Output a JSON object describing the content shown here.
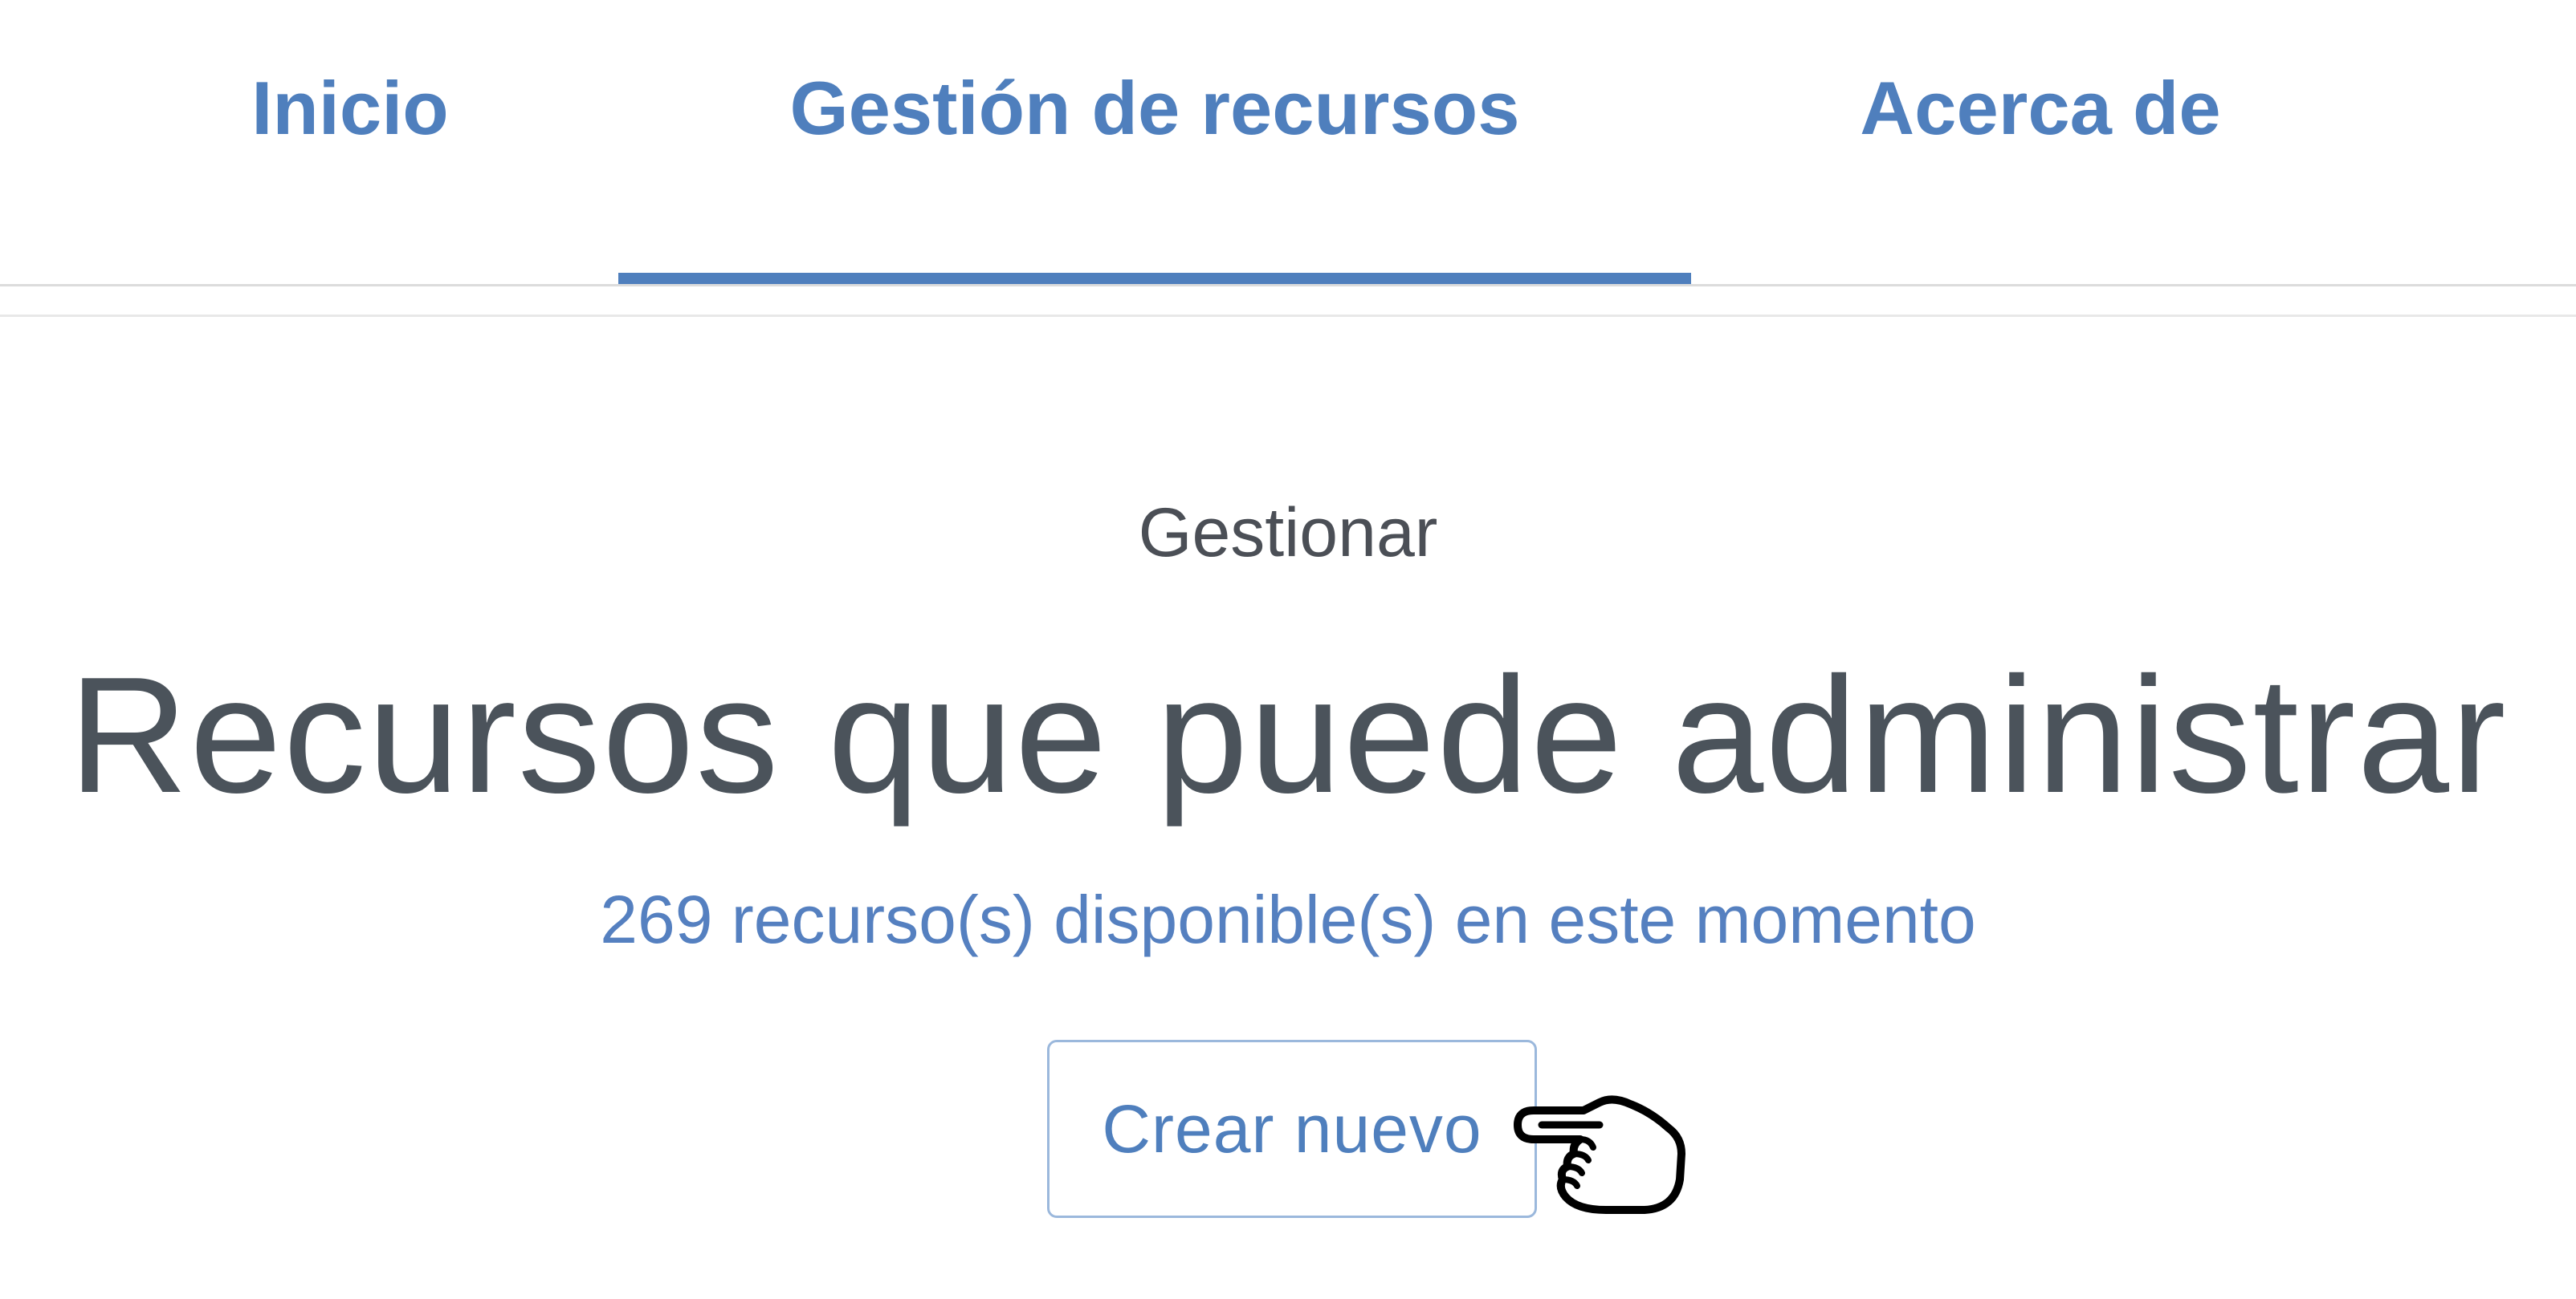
{
  "nav": {
    "tabs": [
      {
        "label": "Inicio",
        "active": false
      },
      {
        "label": "Gestión de recursos",
        "active": true
      },
      {
        "label": "Acerca de",
        "active": false
      }
    ]
  },
  "main": {
    "eyebrow": "Gestionar",
    "headline": "Recursos que puede administrar",
    "subtext": "269 recurso(s) disponible(s) en este momento",
    "create_button_label": "Crear nuevo"
  },
  "cursor": {
    "icon": "hand-pointer-icon"
  },
  "colors": {
    "accent": "#4f7fbd",
    "heading_text": "#4b535b",
    "eyebrow_text": "#4b4f56",
    "button_border": "#9bb8dc",
    "divider": "#dcdcdc"
  }
}
